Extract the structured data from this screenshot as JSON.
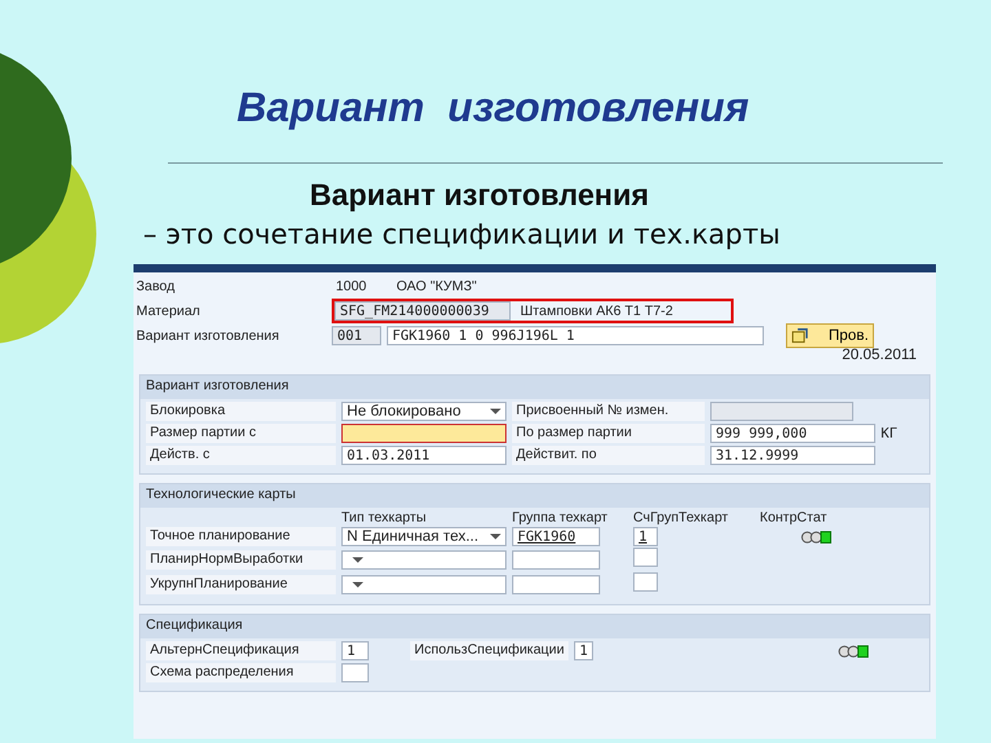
{
  "slide": {
    "title": "Вариант  изготовления",
    "subtitle_lines": [
      "Вариант изготовления",
      "– это сочетание спецификации и тех.карты"
    ]
  },
  "header": {
    "plant": {
      "label": "Завод",
      "code": "1000",
      "name": "ОАО \"КУМЗ\""
    },
    "material": {
      "label": "Материал",
      "code": "SFG_FM214000000039",
      "description": "Штамповки АК6 Т1 Т7-2",
      "highlighted": true
    },
    "variant": {
      "label": "Вариант изготовления",
      "code": "001",
      "description": "FGK1960 1 0 996J196L 1"
    },
    "check_button": {
      "label": "Пров."
    },
    "date": "20.05.2011"
  },
  "variant_section": {
    "title": "Вариант изготовления",
    "rows": [
      {
        "left": {
          "label": "Блокировка",
          "kind": "dropdown",
          "value": "Не блокировано"
        },
        "right": {
          "label": "Присвоенный № измен.",
          "kind": "disabled"
        }
      },
      {
        "left": {
          "label": "Размер партии с",
          "kind": "required"
        },
        "right": {
          "label": "По размер партии",
          "kind": "input",
          "value": "999 999,000",
          "unit": "КГ"
        }
      },
      {
        "left": {
          "label": "Действ. с",
          "kind": "input",
          "value": "01.03.2011"
        },
        "right": {
          "label": "Действит. по",
          "kind": "input",
          "value": "31.12.9999"
        }
      }
    ]
  },
  "routing_section": {
    "title": "Технологические карты",
    "columns": [
      "Тип техкарты",
      "Группа техкарт",
      "СчГрупТехкарт",
      "КонтрСтат"
    ],
    "rows": [
      {
        "label": "Точное планирование",
        "type": "N Единичная тех...",
        "group": "FGK1960",
        "counter": "1",
        "status": true
      },
      {
        "label": "ПланирНормВыработки",
        "status": false
      },
      {
        "label": "УкрупнПланирование",
        "status": false
      }
    ]
  },
  "bom_section": {
    "title": "Спецификация",
    "rows": [
      {
        "left": {
          "label": "АльтернСпецификация",
          "value": "1"
        },
        "right": {
          "label": "ИспользСпецификации",
          "value": "1"
        },
        "status": true
      },
      {
        "left": {
          "label": "Схема распределения"
        },
        "status": false
      }
    ]
  }
}
